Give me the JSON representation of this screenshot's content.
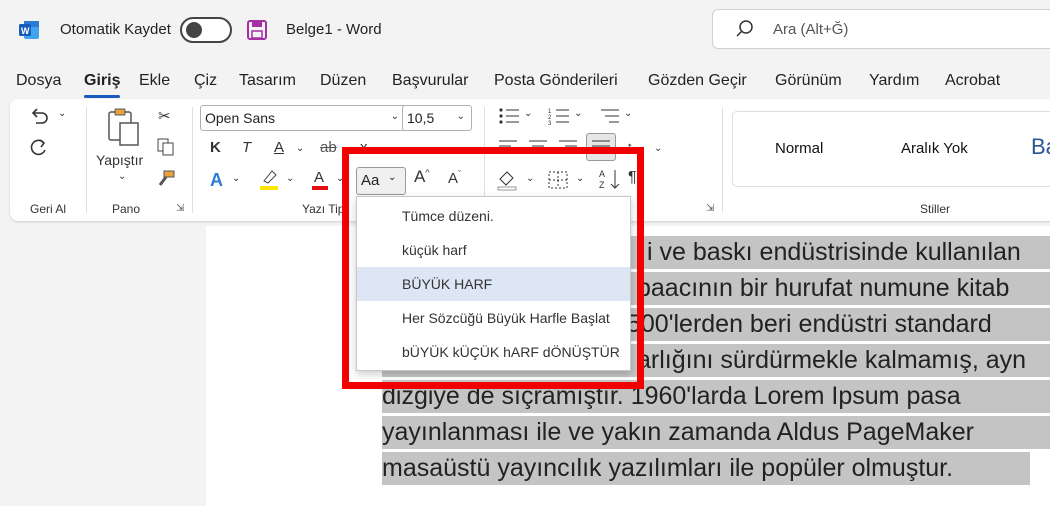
{
  "titlebar": {
    "autosave_label": "Otomatik Kaydet",
    "doc_title": "Belge1  -  Word",
    "search_placeholder": "Ara (Alt+Ğ)"
  },
  "tabs": [
    "Dosya",
    "Giriş",
    "Ekle",
    "Çiz",
    "Tasarım",
    "Düzen",
    "Başvurular",
    "Posta Gönderileri",
    "Gözden Geçir",
    "Görünüm",
    "Yardım",
    "Acrobat"
  ],
  "ribbon": {
    "groups": {
      "undo": "Geri Al",
      "clipboard": "Pano",
      "font": "Yazı Tipi",
      "styles": "Stiller"
    },
    "paste_label": "Yapıştır",
    "font_name": "Open Sans",
    "font_size": "10,5",
    "case_button": "Aa",
    "bold": "K",
    "italic": "T",
    "underline": "A",
    "strike": "ab",
    "sub": "x",
    "styles": [
      "Normal",
      "Aralık Yok",
      "Ba"
    ]
  },
  "case_menu": {
    "items": [
      "Tümce düzeni.",
      "küçük harf",
      "BÜYÜK HARF",
      "Her Sözcüğü Büyük Harfle Başlat",
      "bÜYÜK kÜÇÜK hARF dÖNÜŞTÜR"
    ],
    "highlighted_index": 2
  },
  "document": {
    "lines": [
      {
        "pre": "",
        "text": "i ve baskı endüstrisinde kullanılan"
      },
      {
        "pre": "",
        "text": "baacının bir hurufat numune kitab"
      },
      {
        "pre": "",
        "text": "500'lerden beri endüstri standard"
      },
      {
        "pre": "",
        "text": "arlığını sürdürmekle kalmamış, ayn"
      },
      {
        "pre": "",
        "text": "dizgiye de sıçramıştır. 1960'larda Lorem Ipsum pasa"
      },
      {
        "pre": "",
        "text": "yayınlanması ile ve yakın zamanda Aldus PageMaker"
      },
      {
        "pre": "",
        "text": "masaüstü yayıncılık yazılımları ile popüler olmuştur."
      }
    ]
  },
  "colors": {
    "accent": "#185abd",
    "highlight_box": "#f20000",
    "word_blue": "#185abd"
  }
}
